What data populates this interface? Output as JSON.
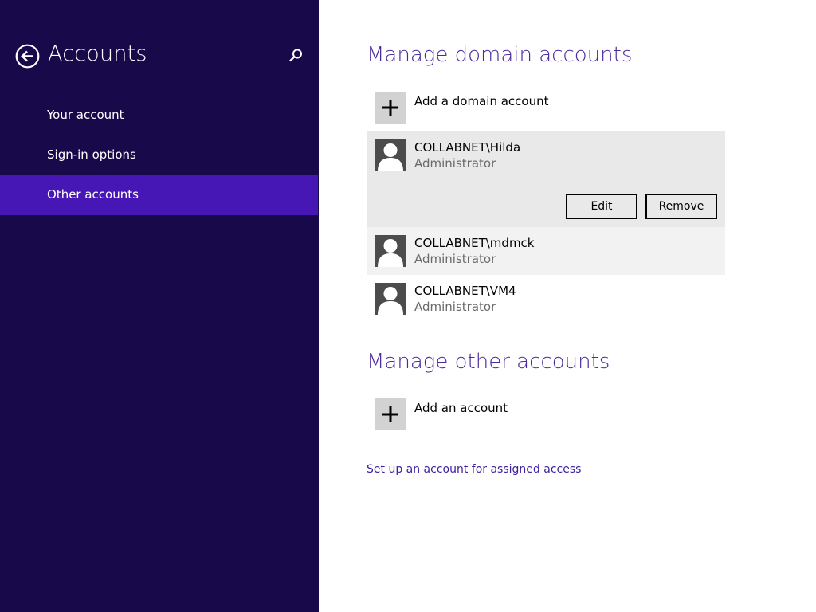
{
  "sidebar": {
    "title": "Accounts",
    "back_icon": "back-arrow-icon",
    "search_icon": "search-icon",
    "nav": [
      {
        "label": "Your account",
        "active": false
      },
      {
        "label": "Sign-in options",
        "active": false
      },
      {
        "label": "Other accounts",
        "active": true
      }
    ]
  },
  "colors": {
    "sidebar_bg": "#180a4a",
    "nav_active": "#4617b4",
    "heading": "#4a2a9c",
    "link": "#3e1f9b",
    "selected_row": "#e9e9e9"
  },
  "domain_section": {
    "title": "Manage domain accounts",
    "add_label": "Add a domain account",
    "accounts": [
      {
        "name": "COLLABNET\\Hilda",
        "role": "Administrator",
        "state": "selected"
      },
      {
        "name": "COLLABNET\\mdmck",
        "role": "Administrator",
        "state": "hover"
      },
      {
        "name": "COLLABNET\\VM4",
        "role": "Administrator",
        "state": "normal"
      }
    ],
    "edit_label": "Edit",
    "remove_label": "Remove"
  },
  "other_section": {
    "title": "Manage other accounts",
    "add_label": "Add an account"
  },
  "assigned_access_link": "Set up an account for assigned access"
}
